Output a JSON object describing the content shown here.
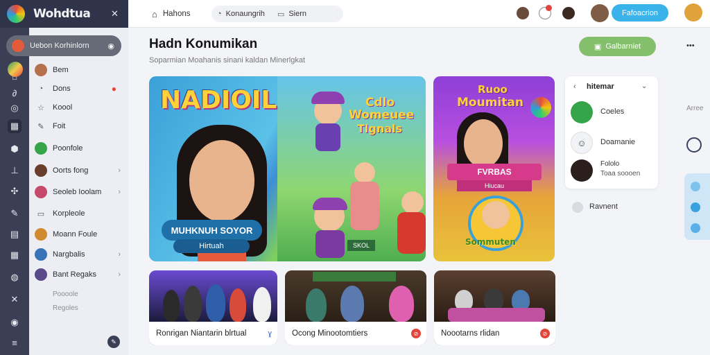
{
  "brand": {
    "name": "Wohdtua",
    "close_icon": "✕"
  },
  "sidebar": {
    "search_label": "Uebon Korhinlorn",
    "items": [
      {
        "label": "Bem",
        "avatar_color": "#b5704d",
        "name": "sidebar-item-bem"
      },
      {
        "label": "Dons",
        "icon": "chat-icon",
        "badge": "●",
        "name": "sidebar-item-dons"
      },
      {
        "label": "Koool",
        "icon": "star-icon",
        "name": "sidebar-item-koool"
      },
      {
        "label": "Foit",
        "icon": "edit-icon",
        "name": "sidebar-item-foit"
      },
      {
        "label": "Poonfole",
        "avatar_color": "#36a44a",
        "name": "sidebar-item-poonfole"
      },
      {
        "label": "Oorts fong",
        "avatar_color": "#6b3d2c",
        "name": "sidebar-item-oorts-fong"
      },
      {
        "label": "Seoleb Ioolam",
        "avatar_color": "#c64a6a",
        "name": "sidebar-item-seoleb-ioolam"
      },
      {
        "label": "Korpleole",
        "icon": "doc-icon",
        "name": "sidebar-item-korpleole"
      },
      {
        "label": "Moann Foule",
        "avatar_color": "#d08a2f",
        "name": "sidebar-item-moann-foule"
      },
      {
        "label": "Nargbalis",
        "avatar_color": "#3a72b8",
        "name": "sidebar-item-nargbalis"
      },
      {
        "label": "Bant Regaks",
        "avatar_color": "#5a4a8a",
        "name": "sidebar-item-bant-regaks"
      },
      {
        "label": "Poooole",
        "name": "sidebar-item-poooole"
      },
      {
        "label": "Regoles",
        "name": "sidebar-item-regoles"
      }
    ]
  },
  "topbar": {
    "home": "Hahons",
    "tab2": "Konaungrih",
    "tab3": "Siern",
    "action_button": "Fafoacrion"
  },
  "main": {
    "title": "Hadn Konumikan",
    "subtitle": "Soparmian Moahanis sinani kaldan Minerlgkat",
    "join_button": "Galbarniet",
    "more": "•••",
    "hero1": {
      "headline": "NADIOIL",
      "banner": "MUHKNUH SOYOR",
      "sub": "Hirtuah",
      "right_title": "Cdlo",
      "right_line2": "Womeuee",
      "right_line3": "Tlgnals",
      "badge": "SKOL"
    },
    "hero2": {
      "headline_top": "Ruoo",
      "headline": "Moumitan",
      "ribbon": "FVRBAS",
      "ribbon_sub": "Hiucau",
      "medal": "Sommuten"
    },
    "thumbs": [
      {
        "caption": "Ronrigan Niantarin blrtual",
        "badge": "ɣ"
      },
      {
        "caption": "Ocong Minootomtiers",
        "badge": "⊘"
      },
      {
        "caption": "Noootarns rlidan",
        "badge": "⊘"
      }
    ]
  },
  "panel": {
    "header": "hitemar",
    "items": [
      {
        "label": "Coeles",
        "color": "#36a44a"
      },
      {
        "label": "Doamanie",
        "color": "#ffffff"
      },
      {
        "label": "Fololo",
        "label2": "Toaa soooen",
        "color": "#2a1f1c"
      }
    ],
    "footer": "Ravnent"
  },
  "farright": {
    "label": "Arree"
  }
}
